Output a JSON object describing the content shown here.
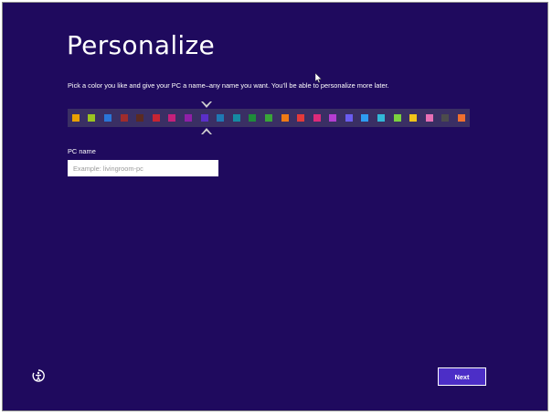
{
  "theme": {
    "background": "#1f0a5e",
    "accent": "#4c2ec7",
    "palette_track": "#3a2f64"
  },
  "page": {
    "title": "Personalize",
    "subtitle": "Pick a color you like and give your PC a name–any name you want. You’ll be able to personalize more later."
  },
  "palette": {
    "selected_index": 8,
    "colors": [
      "#e9a000",
      "#9bc421",
      "#2a75d8",
      "#a02c2c",
      "#5a2a22",
      "#c72432",
      "#c5207b",
      "#8f1fa8",
      "#5b2fc9",
      "#1f78b4",
      "#158aa3",
      "#1e8c3a",
      "#39a538",
      "#ef7a15",
      "#e33a3a",
      "#dc2a7a",
      "#b43dd2",
      "#6a5cf0",
      "#2e9cf2",
      "#32b8d8",
      "#7bd23f",
      "#f0c419",
      "#e76fb5",
      "#4c4c4c",
      "#ef6f2e"
    ]
  },
  "pc_name": {
    "label": "PC name",
    "placeholder": "Example: livingroom-pc",
    "value": ""
  },
  "icons": {
    "ease_of_access": "ease-of-access-icon",
    "cursor": "mouse-cursor-icon"
  },
  "buttons": {
    "next_label": "Next"
  }
}
